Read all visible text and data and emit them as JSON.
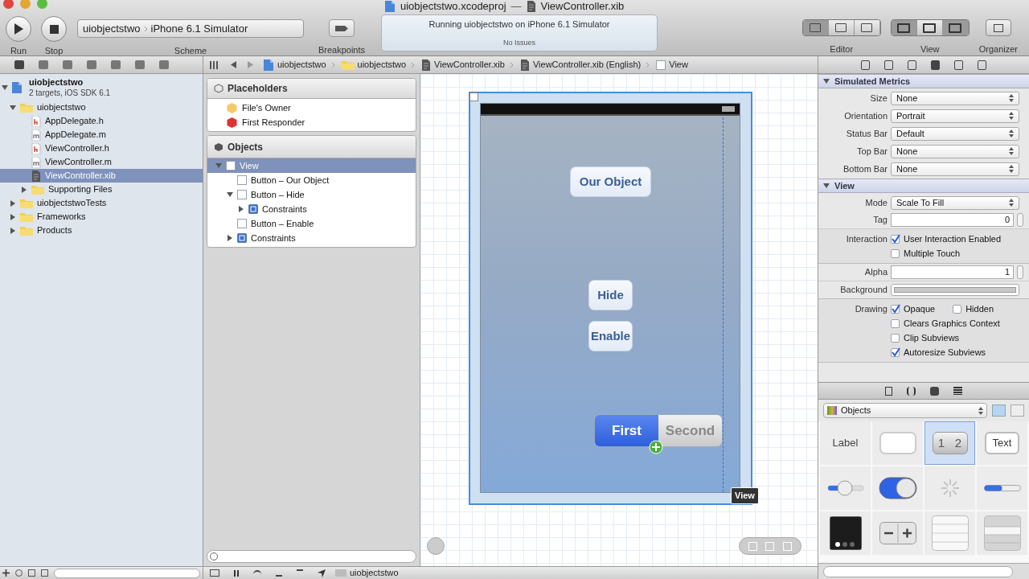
{
  "window": {
    "project_title": "uiobjectstwo.xcodeproj",
    "separator": "—",
    "file_title": "ViewController.xib"
  },
  "toolbar": {
    "run": "Run",
    "stop": "Stop",
    "scheme_path": [
      "uiobjectstwo",
      "iPhone 6.1 Simulator"
    ],
    "scheme_label": "Scheme",
    "breakpoints": "Breakpoints",
    "activity": {
      "status": "Running uiobjectstwo on iPhone 6.1 Simulator",
      "issues": "No Issues"
    },
    "editor": "Editor",
    "view": "View",
    "organizer": "Organizer"
  },
  "jump_bar": [
    {
      "kind": "project",
      "label": "uiobjectstwo"
    },
    {
      "kind": "folder",
      "label": "uiobjectstwo"
    },
    {
      "kind": "xib",
      "label": "ViewController.xib"
    },
    {
      "kind": "xib",
      "label": "ViewController.xib (English)"
    },
    {
      "kind": "view",
      "label": "View"
    }
  ],
  "navigator": {
    "items": [
      {
        "kind": "project",
        "name": "uiobjectstwo",
        "subtitle": "2 targets, iOS SDK 6.1",
        "expanded": true,
        "selected": false,
        "children": [
          {
            "kind": "folder",
            "name": "uiobjectstwo",
            "expanded": true,
            "selected": false,
            "children": [
              {
                "kind": "header",
                "name": "AppDelegate.h",
                "selected": false
              },
              {
                "kind": "source",
                "name": "AppDelegate.m",
                "selected": false
              },
              {
                "kind": "header",
                "name": "ViewController.h",
                "selected": false
              },
              {
                "kind": "source",
                "name": "ViewController.m",
                "selected": false
              },
              {
                "kind": "xib",
                "name": "ViewController.xib",
                "selected": true
              },
              {
                "kind": "folder",
                "name": "Supporting Files",
                "expanded": false,
                "selected": false
              }
            ]
          },
          {
            "kind": "folder",
            "name": "uiobjectstwoTests",
            "expanded": false,
            "selected": false
          },
          {
            "kind": "folder",
            "name": "Frameworks",
            "expanded": false,
            "selected": false
          },
          {
            "kind": "folder",
            "name": "Products",
            "expanded": false,
            "selected": false
          }
        ]
      }
    ]
  },
  "outline": {
    "placeholders": {
      "title": "Placeholders",
      "items": [
        {
          "kind": "owner",
          "label": "File's Owner"
        },
        {
          "kind": "responder",
          "label": "First Responder"
        }
      ]
    },
    "objects": {
      "title": "Objects",
      "items": [
        {
          "kind": "view",
          "label": "View",
          "expanded": true,
          "selected": true,
          "children": [
            {
              "kind": "button",
              "label": "Button – Our Object",
              "selected": false
            },
            {
              "kind": "button",
              "label": "Button – Hide",
              "expanded": true,
              "selected": false,
              "children": [
                {
                  "kind": "constraints",
                  "label": "Constraints",
                  "expanded": false,
                  "selected": false
                }
              ]
            },
            {
              "kind": "button",
              "label": "Button – Enable",
              "selected": false
            },
            {
              "kind": "constraints",
              "label": "Constraints",
              "expanded": false,
              "selected": false
            }
          ]
        }
      ]
    }
  },
  "canvas": {
    "buttons": [
      {
        "label": "Our Object"
      },
      {
        "label": "Hide"
      },
      {
        "label": "Enable"
      }
    ],
    "segmented": [
      {
        "label": "First",
        "selected": true
      },
      {
        "label": "Second",
        "selected": false
      }
    ],
    "selection_label": "View"
  },
  "inspector": {
    "sections": [
      {
        "title": "Simulated Metrics",
        "expanded": true,
        "rows": [
          {
            "kind": "popup",
            "label": "Size",
            "value": "None"
          },
          {
            "kind": "popup",
            "label": "Orientation",
            "value": "Portrait"
          },
          {
            "kind": "popup",
            "label": "Status Bar",
            "value": "Default"
          },
          {
            "kind": "popup",
            "label": "Top Bar",
            "value": "None"
          },
          {
            "kind": "popup",
            "label": "Bottom Bar",
            "value": "None"
          }
        ]
      },
      {
        "title": "View",
        "expanded": true,
        "rows": [
          {
            "kind": "popup",
            "label": "Mode",
            "value": "Scale To Fill"
          },
          {
            "kind": "stepper",
            "label": "Tag",
            "value": "0"
          },
          {
            "kind": "checks",
            "label": "Interaction",
            "lines": [
              [
                {
                  "label": "User Interaction Enabled",
                  "checked": true
                }
              ],
              [
                {
                  "label": "Multiple Touch",
                  "checked": false
                }
              ]
            ]
          },
          {
            "kind": "stepper",
            "label": "Alpha",
            "value": "1"
          },
          {
            "kind": "color",
            "label": "Background"
          },
          {
            "kind": "checks",
            "label": "Drawing",
            "lines": [
              [
                {
                  "label": "Opaque",
                  "checked": true
                },
                {
                  "label": "Hidden",
                  "checked": false
                }
              ],
              [
                {
                  "label": "Clears Graphics Context",
                  "checked": false
                }
              ],
              [
                {
                  "label": "Clip Subviews",
                  "checked": false
                }
              ],
              [
                {
                  "label": "Autoresize Subviews",
                  "checked": true
                }
              ]
            ]
          }
        ]
      }
    ]
  },
  "library": {
    "filter": "Objects",
    "tiles": [
      {
        "kind": "label",
        "text": "Label",
        "selected": false
      },
      {
        "kind": "round_button",
        "selected": false
      },
      {
        "kind": "segmented",
        "segments": [
          "1",
          "2"
        ],
        "selected": true
      },
      {
        "kind": "text_field",
        "text": "Text",
        "selected": false
      },
      {
        "kind": "slider",
        "selected": false
      },
      {
        "kind": "switch",
        "selected": false
      },
      {
        "kind": "activity",
        "selected": false
      },
      {
        "kind": "progress",
        "selected": false
      },
      {
        "kind": "page_control",
        "selected": false
      },
      {
        "kind": "stepper",
        "selected": false
      },
      {
        "kind": "table",
        "selected": false
      },
      {
        "kind": "table_grouped",
        "selected": false
      }
    ]
  },
  "debug_bar": {
    "scheme": "uiobjectstwo"
  }
}
